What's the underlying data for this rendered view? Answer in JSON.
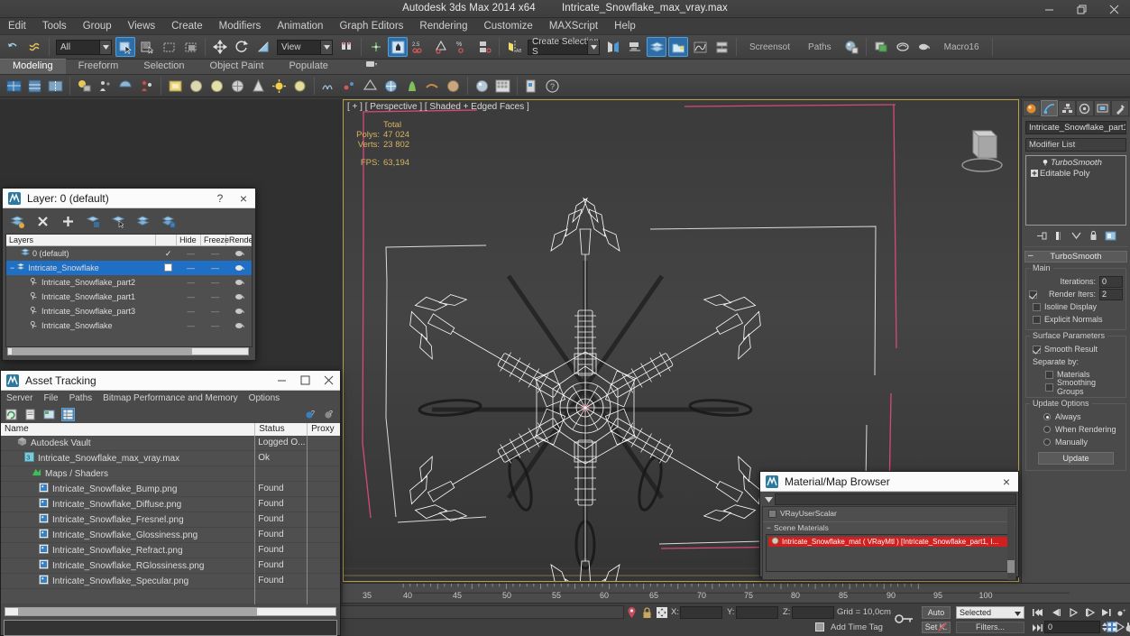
{
  "app": {
    "title": "Autodesk 3ds Max  2014 x64",
    "filename": "Intricate_Snowflake_max_vray.max"
  },
  "window_controls": [
    {
      "name": "minimize",
      "glyph": "minimize-icon"
    },
    {
      "name": "restore",
      "glyph": "restore-icon"
    },
    {
      "name": "close",
      "glyph": "close-icon"
    }
  ],
  "menubar": {
    "items": [
      "Edit",
      "Tools",
      "Group",
      "Views",
      "Create",
      "Modifiers",
      "Animation",
      "Graph Editors",
      "Rendering",
      "Customize",
      "MAXScript",
      "Help"
    ]
  },
  "main_toolbar": {
    "selection_filter": "All",
    "reference_coord": "View",
    "named_selection_set": "Create Selection S",
    "screenshot_label": "Screensot",
    "paths_label": "Paths",
    "macro_label": "Macro16"
  },
  "ribbon": {
    "tabs": [
      {
        "label": "Modeling",
        "active": true
      },
      {
        "label": "Freeform",
        "active": false
      },
      {
        "label": "Selection",
        "active": false
      },
      {
        "label": "Object Paint",
        "active": false
      },
      {
        "label": "Populate",
        "active": false
      }
    ]
  },
  "viewport": {
    "label": "[ + ] [ Perspective ] [ Shaded + Edged Faces ]",
    "stats_header": "Total",
    "stats": [
      {
        "label": "Polys:",
        "value": "47 024"
      },
      {
        "label": "Verts:",
        "value": "23 802"
      }
    ],
    "fps_label": "FPS:",
    "fps_value": "63,194"
  },
  "layer_dialog": {
    "title": "Layer: 0 (default)",
    "help_glyph": "?",
    "close_glyph": "×",
    "columns": [
      "Layers",
      "",
      "Hide",
      "Freeze",
      "Rende"
    ],
    "rows": [
      {
        "name": "0 (default)",
        "indent": 0,
        "selected": false,
        "check": "✓",
        "hide": "—",
        "freeze": "—",
        "render": true
      },
      {
        "name": "Intricate_Snowflake",
        "indent": 0,
        "selected": true,
        "check": "",
        "hide": "—",
        "freeze": "—",
        "render": true
      },
      {
        "name": "Intricate_Snowflake_part2",
        "indent": 1,
        "selected": false,
        "check": "",
        "hide": "—",
        "freeze": "—",
        "render": true
      },
      {
        "name": "Intricate_Snowflake_part1",
        "indent": 1,
        "selected": false,
        "check": "",
        "hide": "—",
        "freeze": "—",
        "render": true
      },
      {
        "name": "Intricate_Snowflake_part3",
        "indent": 1,
        "selected": false,
        "check": "",
        "hide": "—",
        "freeze": "—",
        "render": true
      },
      {
        "name": "Intricate_Snowflake",
        "indent": 1,
        "selected": false,
        "check": "",
        "hide": "—",
        "freeze": "—",
        "render": true
      }
    ]
  },
  "asset_dialog": {
    "title": "Asset Tracking",
    "menu": [
      "Server",
      "File",
      "Paths",
      "Bitmap Performance and Memory",
      "Options"
    ],
    "columns": [
      "Name",
      "Status",
      "Proxy"
    ],
    "rows": [
      {
        "name": "Autodesk Vault",
        "status": "Logged O...",
        "indent": 0,
        "icon": "vault-icon"
      },
      {
        "name": "Intricate_Snowflake_max_vray.max",
        "status": "Ok",
        "indent": 1,
        "icon": "max-file-icon"
      },
      {
        "name": "Maps / Shaders",
        "status": "",
        "indent": 2,
        "icon": "maps-icon"
      },
      {
        "name": "Intricate_Snowflake_Bump.png",
        "status": "Found",
        "indent": 3,
        "icon": "bitmap-icon"
      },
      {
        "name": "Intricate_Snowflake_Diffuse.png",
        "status": "Found",
        "indent": 3,
        "icon": "bitmap-icon"
      },
      {
        "name": "Intricate_Snowflake_Fresnel.png",
        "status": "Found",
        "indent": 3,
        "icon": "bitmap-icon"
      },
      {
        "name": "Intricate_Snowflake_Glossiness.png",
        "status": "Found",
        "indent": 3,
        "icon": "bitmap-icon"
      },
      {
        "name": "Intricate_Snowflake_Refract.png",
        "status": "Found",
        "indent": 3,
        "icon": "bitmap-icon"
      },
      {
        "name": "Intricate_Snowflake_RGlossiness.png",
        "status": "Found",
        "indent": 3,
        "icon": "bitmap-icon"
      },
      {
        "name": "Intricate_Snowflake_Specular.png",
        "status": "Found",
        "indent": 3,
        "icon": "bitmap-icon"
      }
    ]
  },
  "material_browser": {
    "title": "Material/Map Browser",
    "close_glyph": "×",
    "search_value": "",
    "top_item": "VRayUserScalar",
    "group_label": "Scene Materials",
    "selected_material": "Intricate_Snowflake_mat  ( VRayMtl )  [Intricate_Snowflake_part1, I..."
  },
  "command_panel": {
    "tabs": [
      "create-tab",
      "modify-tab",
      "hierarchy-tab",
      "motion-tab",
      "display-tab",
      "utilities-tab"
    ],
    "selected_tab_index": 1,
    "object_name": "Intricate_Snowflake_part1",
    "modifier_list_label": "Modifier List",
    "stack": [
      {
        "label": "TurboSmooth",
        "italic": true
      },
      {
        "label": "Editable Poly",
        "italic": false
      }
    ],
    "rollout_title": "TurboSmooth",
    "groups": [
      {
        "title": "Main",
        "rows": [
          {
            "type": "spin",
            "label": "Iterations:",
            "value": "0",
            "checkbox": null
          },
          {
            "type": "spin",
            "label": "Render Iters:",
            "value": "2",
            "checkbox": true
          },
          {
            "type": "check",
            "label": "Isoline Display",
            "checked": false
          },
          {
            "type": "check",
            "label": "Explicit Normals",
            "checked": false
          }
        ]
      },
      {
        "title": "Surface Parameters",
        "rows": [
          {
            "type": "check",
            "label": "Smooth Result",
            "checked": true
          },
          {
            "type": "text",
            "label": "Separate by:"
          },
          {
            "type": "check",
            "label": "Materials",
            "checked": false,
            "indent": true
          },
          {
            "type": "check",
            "label": "Smoothing Groups",
            "checked": false,
            "indent": true
          }
        ]
      },
      {
        "title": "Update Options",
        "rows": [
          {
            "type": "radio",
            "label": "Always",
            "checked": true
          },
          {
            "type": "radio",
            "label": "When Rendering",
            "checked": false
          },
          {
            "type": "radio",
            "label": "Manually",
            "checked": false
          }
        ],
        "button": "Update"
      }
    ]
  },
  "timeline": {
    "labels": [
      "35",
      "40",
      "45",
      "50",
      "55",
      "60",
      "65",
      "70",
      "75",
      "80",
      "85",
      "90",
      "95",
      "100"
    ]
  },
  "statusbar": {
    "coord_labels": [
      "X:",
      "Y:",
      "Z:"
    ],
    "coord_values": [
      "",
      "",
      ""
    ],
    "grid_text": "Grid = 10,0cm",
    "time_tag": "Add Time Tag",
    "auto_key": "Auto",
    "set_key": "Set K.",
    "key_filter_mode": "Selected",
    "filters_label": "Filters...",
    "frame_value": "0"
  },
  "colors": {
    "accent_blue": "#2d6ea8",
    "selection_blue": "#1f6fc4",
    "viewport_bg": "#3f3f3f",
    "viewport_border": "#b6a04a",
    "panel_bg": "#4a4a4a",
    "stats_text": "#d8b463",
    "material_selected": "#cf1f1f",
    "gizmo_pink": "#d64d7e"
  }
}
